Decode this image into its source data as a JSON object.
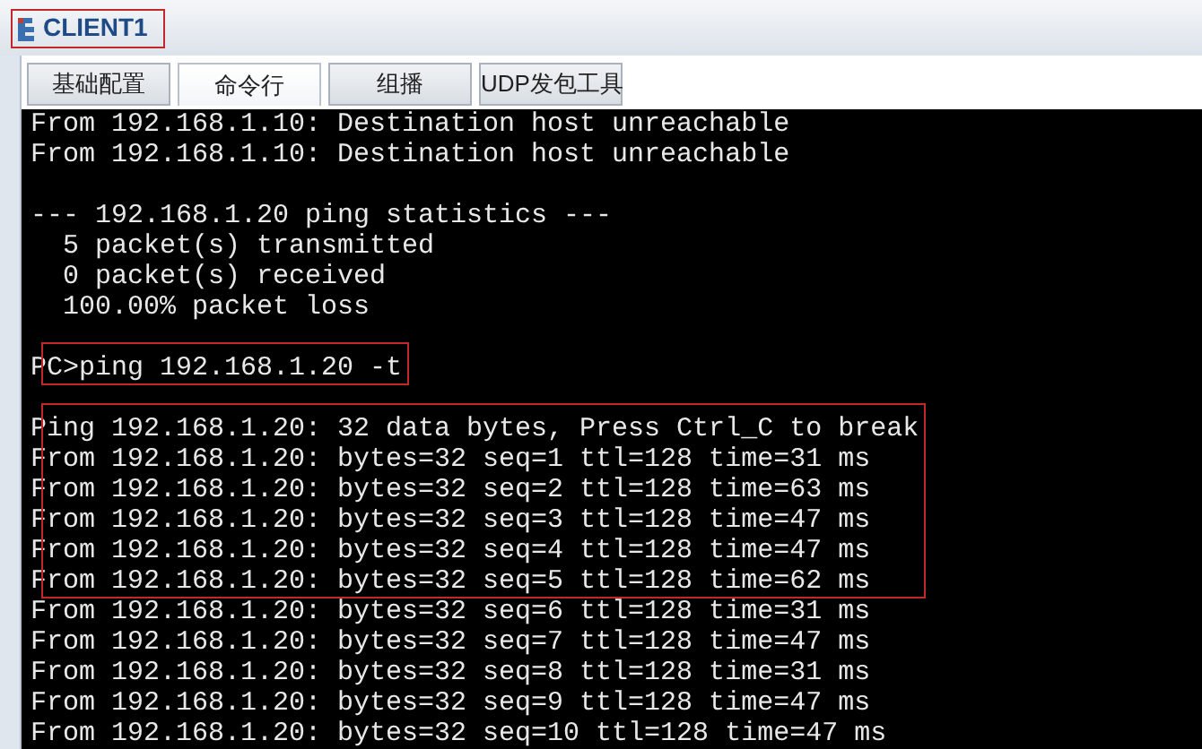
{
  "window": {
    "title": "CLIENT1",
    "highlighted": true
  },
  "tabs": [
    {
      "label": "基础配置",
      "selected": false
    },
    {
      "label": "命令行",
      "selected": true
    },
    {
      "label": "组播",
      "selected": false
    },
    {
      "label": "UDP发包工具",
      "selected": false
    }
  ],
  "terminal": {
    "lines": [
      {
        "kind": "output",
        "text": "From 192.168.1.10: Destination host unreachable",
        "highlighted": false
      },
      {
        "kind": "output",
        "text": "From 192.168.1.10: Destination host unreachable",
        "highlighted": false
      },
      {
        "kind": "blank"
      },
      {
        "kind": "output",
        "text": "--- 192.168.1.20 ping statistics ---",
        "highlighted": false
      },
      {
        "kind": "output",
        "text": "  5 packet(s) transmitted",
        "highlighted": false
      },
      {
        "kind": "output",
        "text": "  0 packet(s) received",
        "highlighted": false
      },
      {
        "kind": "output",
        "text": "  100.00% packet loss",
        "highlighted": false
      },
      {
        "kind": "blank"
      },
      {
        "kind": "command",
        "text": "PC>ping 192.168.1.20 -t",
        "highlighted": true
      },
      {
        "kind": "blank"
      },
      {
        "kind": "output",
        "text": "Ping 192.168.1.20: 32 data bytes, Press Ctrl_C to break",
        "highlighted": true
      },
      {
        "kind": "output",
        "text": "From 192.168.1.20: bytes=32 seq=1 ttl=128 time=31 ms",
        "highlighted": true
      },
      {
        "kind": "output",
        "text": "From 192.168.1.20: bytes=32 seq=2 ttl=128 time=63 ms",
        "highlighted": true
      },
      {
        "kind": "output",
        "text": "From 192.168.1.20: bytes=32 seq=3 ttl=128 time=47 ms",
        "highlighted": true
      },
      {
        "kind": "output",
        "text": "From 192.168.1.20: bytes=32 seq=4 ttl=128 time=47 ms",
        "highlighted": true
      },
      {
        "kind": "output",
        "text": "From 192.168.1.20: bytes=32 seq=5 ttl=128 time=62 ms",
        "highlighted": true
      },
      {
        "kind": "output",
        "text": "From 192.168.1.20: bytes=32 seq=6 ttl=128 time=31 ms",
        "highlighted": false
      },
      {
        "kind": "output",
        "text": "From 192.168.1.20: bytes=32 seq=7 ttl=128 time=47 ms",
        "highlighted": false
      },
      {
        "kind": "output",
        "text": "From 192.168.1.20: bytes=32 seq=8 ttl=128 time=31 ms",
        "highlighted": false
      },
      {
        "kind": "output",
        "text": "From 192.168.1.20: bytes=32 seq=9 ttl=128 time=47 ms",
        "highlighted": false
      },
      {
        "kind": "output",
        "text": "From 192.168.1.20: bytes=32 seq=10 ttl=128 time=47 ms",
        "highlighted": false
      }
    ]
  }
}
